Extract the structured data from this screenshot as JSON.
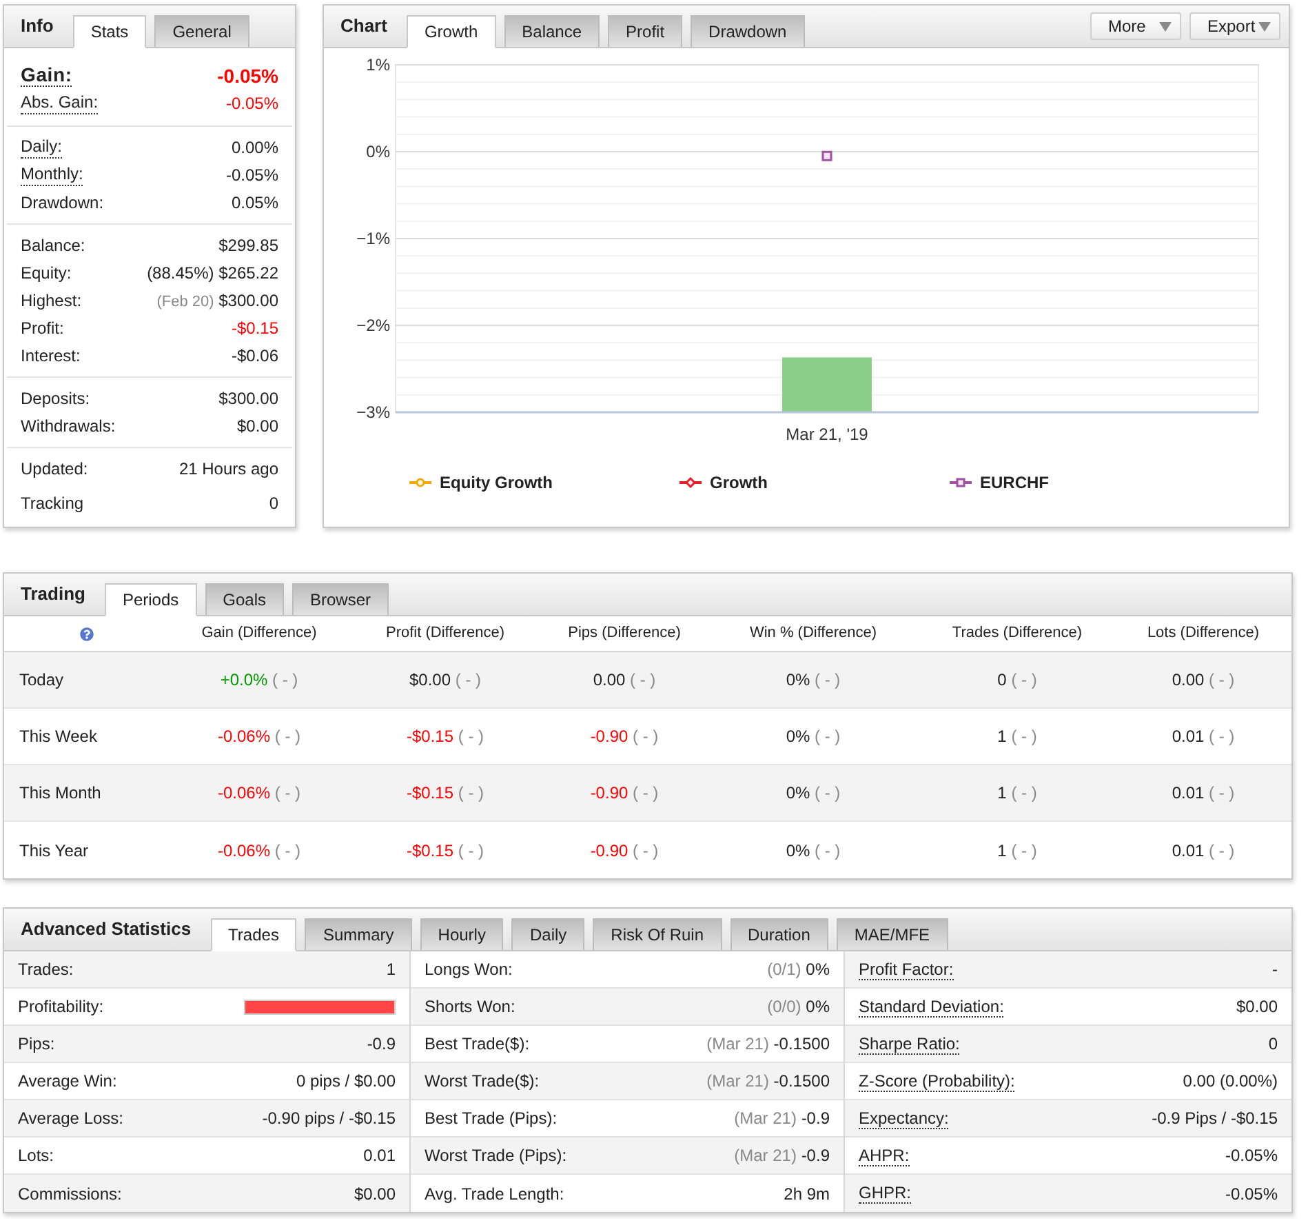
{
  "info": {
    "title": "Info",
    "tabs": [
      {
        "label": "Stats",
        "selected": true
      },
      {
        "label": "General",
        "selected": false
      }
    ],
    "groups": [
      [
        {
          "label": "Gain:",
          "value": "-0.05%",
          "negative": true,
          "strong": true,
          "underlined": true
        },
        {
          "label": "Abs. Gain:",
          "value": "-0.05%",
          "negative": true,
          "strong": false,
          "underlined": true
        }
      ],
      [
        {
          "label": "Daily:",
          "value": "0.00%",
          "negative": false,
          "strong": false,
          "underlined": true
        },
        {
          "label": "Monthly:",
          "value": "-0.05%",
          "negative": false,
          "strong": false,
          "underlined": true
        },
        {
          "label": "Drawdown:",
          "value": "0.05%",
          "negative": false,
          "strong": false,
          "underlined": false
        }
      ],
      [
        {
          "label": "Balance:",
          "value": "$299.85",
          "negative": false,
          "strong": false,
          "underlined": false
        },
        {
          "label": "Equity:",
          "note": {
            "text": "(88.45%)",
            "muted": false
          },
          "value": "$265.22",
          "negative": false,
          "strong": false,
          "underlined": false
        },
        {
          "label": "Highest:",
          "note": {
            "text": "(Feb 20)",
            "muted": true
          },
          "value": "$300.00",
          "negative": false,
          "strong": false,
          "underlined": false
        },
        {
          "label": "Profit:",
          "value": "-$0.15",
          "negative": true,
          "strong": false,
          "underlined": false
        },
        {
          "label": "Interest:",
          "value": "-$0.06",
          "negative": false,
          "strong": false,
          "underlined": false
        }
      ],
      [
        {
          "label": "Deposits:",
          "value": "$300.00",
          "negative": false,
          "strong": false,
          "underlined": false
        },
        {
          "label": "Withdrawals:",
          "value": "$0.00",
          "negative": false,
          "strong": false,
          "underlined": false
        }
      ],
      [
        {
          "label": "Updated:",
          "value": "21 Hours ago",
          "negative": false,
          "strong": false,
          "underlined": false
        },
        {
          "label": "Tracking",
          "value": "0",
          "negative": false,
          "strong": false,
          "underlined": false
        }
      ]
    ]
  },
  "chart": {
    "title": "Chart",
    "tabs": [
      {
        "label": "Growth",
        "selected": true
      },
      {
        "label": "Balance",
        "selected": false
      },
      {
        "label": "Profit",
        "selected": false
      },
      {
        "label": "Drawdown",
        "selected": false
      }
    ],
    "buttons": [
      {
        "label": "More"
      },
      {
        "label": "Export"
      }
    ],
    "chart_data": {
      "type": "line",
      "categories": [
        "Mar 21, '19"
      ],
      "ylim": [
        -3,
        1
      ],
      "yticks": [
        {
          "value": 1,
          "label": "1%"
        },
        {
          "value": 0,
          "label": "0%"
        },
        {
          "value": -1,
          "label": "−1%"
        },
        {
          "value": -2,
          "label": "−2%"
        },
        {
          "value": -3,
          "label": "−3%"
        }
      ],
      "grid": true,
      "series": [
        {
          "name": "Equity Growth",
          "marker": "circle",
          "color": "#f5a800",
          "values": [
            null
          ]
        },
        {
          "name": "Growth",
          "marker": "diamond",
          "color": "#e5202b",
          "values": [
            null
          ]
        },
        {
          "name": "EURCHF",
          "marker": "square",
          "color": "#a0529f",
          "values": [
            -0.05
          ]
        }
      ]
    }
  },
  "trading": {
    "title": "Trading",
    "tabs": [
      {
        "label": "Periods",
        "selected": true
      },
      {
        "label": "Goals",
        "selected": false
      },
      {
        "label": "Browser",
        "selected": false
      }
    ],
    "columns": [
      "Gain (Difference)",
      "Profit (Difference)",
      "Pips (Difference)",
      "Win % (Difference)",
      "Trades (Difference)",
      "Lots (Difference)"
    ],
    "rows": [
      {
        "label": "Today",
        "cells": [
          {
            "value": "+0.0%",
            "positive": true,
            "negative": false,
            "diff": "( - )"
          },
          {
            "value": "$0.00",
            "positive": false,
            "negative": false,
            "diff": "( - )"
          },
          {
            "value": "0.00",
            "positive": false,
            "negative": false,
            "diff": "( - )"
          },
          {
            "value": "0%",
            "positive": false,
            "negative": false,
            "diff": "( - )"
          },
          {
            "value": "0",
            "positive": false,
            "negative": false,
            "diff": "( - )"
          },
          {
            "value": "0.00",
            "positive": false,
            "negative": false,
            "diff": "( - )"
          }
        ]
      },
      {
        "label": "This Week",
        "cells": [
          {
            "value": "-0.06%",
            "positive": false,
            "negative": true,
            "diff": "( - )"
          },
          {
            "value": "-$0.15",
            "positive": false,
            "negative": true,
            "diff": "( - )"
          },
          {
            "value": "-0.90",
            "positive": false,
            "negative": true,
            "diff": "( - )"
          },
          {
            "value": "0%",
            "positive": false,
            "negative": false,
            "diff": "( - )"
          },
          {
            "value": "1",
            "positive": false,
            "negative": false,
            "diff": "( - )"
          },
          {
            "value": "0.01",
            "positive": false,
            "negative": false,
            "diff": "( - )"
          }
        ]
      },
      {
        "label": "This Month",
        "cells": [
          {
            "value": "-0.06%",
            "positive": false,
            "negative": true,
            "diff": "( - )"
          },
          {
            "value": "-$0.15",
            "positive": false,
            "negative": true,
            "diff": "( - )"
          },
          {
            "value": "-0.90",
            "positive": false,
            "negative": true,
            "diff": "( - )"
          },
          {
            "value": "0%",
            "positive": false,
            "negative": false,
            "diff": "( - )"
          },
          {
            "value": "1",
            "positive": false,
            "negative": false,
            "diff": "( - )"
          },
          {
            "value": "0.01",
            "positive": false,
            "negative": false,
            "diff": "( - )"
          }
        ]
      },
      {
        "label": "This Year",
        "cells": [
          {
            "value": "-0.06%",
            "positive": false,
            "negative": true,
            "diff": "( - )"
          },
          {
            "value": "-$0.15",
            "positive": false,
            "negative": true,
            "diff": "( - )"
          },
          {
            "value": "-0.90",
            "positive": false,
            "negative": true,
            "diff": "( - )"
          },
          {
            "value": "0%",
            "positive": false,
            "negative": false,
            "diff": "( - )"
          },
          {
            "value": "1",
            "positive": false,
            "negative": false,
            "diff": "( - )"
          },
          {
            "value": "0.01",
            "positive": false,
            "negative": false,
            "diff": "( - )"
          }
        ]
      }
    ]
  },
  "advanced": {
    "title": "Advanced Statistics",
    "tabs": [
      {
        "label": "Trades",
        "selected": true
      },
      {
        "label": "Summary",
        "selected": false
      },
      {
        "label": "Hourly",
        "selected": false
      },
      {
        "label": "Daily",
        "selected": false
      },
      {
        "label": "Risk Of Ruin",
        "selected": false
      },
      {
        "label": "Duration",
        "selected": false
      },
      {
        "label": "MAE/MFE",
        "selected": false
      }
    ],
    "columns": [
      [
        {
          "kind": "text",
          "label": "Trades:",
          "value": "1",
          "underlined": false
        },
        {
          "kind": "bar",
          "label": "Profitability:",
          "level": 1,
          "underlined": false
        },
        {
          "kind": "text",
          "label": "Pips:",
          "value": "-0.9",
          "underlined": false
        },
        {
          "kind": "text",
          "label": "Average Win:",
          "value": "0 pips / $0.00",
          "underlined": false
        },
        {
          "kind": "text",
          "label": "Average Loss:",
          "value": "-0.90 pips / -$0.15",
          "underlined": false
        },
        {
          "kind": "text",
          "label": "Lots:",
          "value": "0.01",
          "underlined": false
        },
        {
          "kind": "text",
          "label": "Commissions:",
          "value": "$0.00",
          "underlined": false
        }
      ],
      [
        {
          "kind": "text",
          "label": "Longs Won:",
          "note": "(0/1)",
          "value": "0%",
          "underlined": false
        },
        {
          "kind": "text",
          "label": "Shorts Won:",
          "note": "(0/0)",
          "value": "0%",
          "underlined": false
        },
        {
          "kind": "text",
          "label": "Best Trade($):",
          "note": "(Mar 21)",
          "value": "-0.1500",
          "underlined": false
        },
        {
          "kind": "text",
          "label": "Worst Trade($):",
          "note": "(Mar 21)",
          "value": "-0.1500",
          "underlined": false
        },
        {
          "kind": "text",
          "label": "Best Trade (Pips):",
          "note": "(Mar 21)",
          "value": "-0.9",
          "underlined": false
        },
        {
          "kind": "text",
          "label": "Worst Trade (Pips):",
          "note": "(Mar 21)",
          "value": "-0.9",
          "underlined": false
        },
        {
          "kind": "text",
          "label": "Avg. Trade Length:",
          "value": "2h 9m",
          "underlined": false
        }
      ],
      [
        {
          "kind": "text",
          "label": "Profit Factor:",
          "value": "-",
          "underlined": true
        },
        {
          "kind": "text",
          "label": "Standard Deviation:",
          "value": "$0.00",
          "underlined": true
        },
        {
          "kind": "text",
          "label": "Sharpe Ratio:",
          "value": "0",
          "underlined": true
        },
        {
          "kind": "text",
          "label": "Z-Score (Probability):",
          "value": "0.00 (0.00%)",
          "underlined": true
        },
        {
          "kind": "text",
          "label": "Expectancy:",
          "value": "-0.9 Pips / -$0.15",
          "underlined": true
        },
        {
          "kind": "text",
          "label": "AHPR:",
          "value": "-0.05%",
          "underlined": true
        },
        {
          "kind": "text",
          "label": "GHPR:",
          "value": "-0.05%",
          "underlined": true
        }
      ]
    ]
  }
}
